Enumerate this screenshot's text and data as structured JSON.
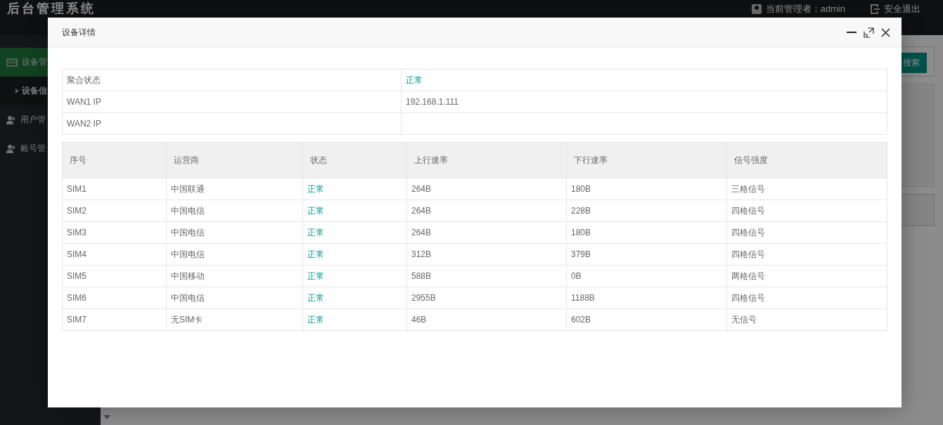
{
  "app": {
    "title": "后台管理系统",
    "admin_label": "当前管理者：admin",
    "logout_label": "安全退出"
  },
  "sidebar": {
    "items": [
      {
        "label": "设备管",
        "selected": true,
        "children": [
          {
            "label": "设备信",
            "selected": false
          }
        ]
      },
      {
        "label": "用户管",
        "selected": false
      },
      {
        "label": "账号管",
        "selected": false
      }
    ]
  },
  "search_button": "搜索",
  "dialog": {
    "title": "设备详情",
    "info": [
      {
        "label": "聚合状态",
        "value": "正常",
        "kind": "status"
      },
      {
        "label": "WAN1 IP",
        "value": "192.168.1.111",
        "kind": "text"
      },
      {
        "label": "WAN2 IP",
        "kind": "text"
      }
    ],
    "table": {
      "columns": [
        {
          "label": "序号",
          "kind": "text"
        },
        {
          "label": "运营商",
          "kind": "text"
        },
        {
          "label": "状态",
          "kind": "status"
        },
        {
          "label": "上行速率",
          "kind": "text"
        },
        {
          "label": "下行速率",
          "kind": "text"
        },
        {
          "label": "信号强度",
          "kind": "text"
        }
      ],
      "rows": [
        [
          "SIM1",
          "中国联通",
          "正常",
          "264B",
          "180B",
          "三格信号"
        ],
        [
          "SIM2",
          "中国电信",
          "正常",
          "264B",
          "228B",
          "四格信号"
        ],
        [
          "SIM3",
          "中国电信",
          "正常",
          "264B",
          "180B",
          "四格信号"
        ],
        [
          "SIM4",
          "中国电信",
          "正常",
          "312B",
          "379B",
          "四格信号"
        ],
        [
          "SIM5",
          "中国移动",
          "正常",
          "588B",
          "0B",
          "两格信号"
        ],
        [
          "SIM6",
          "中国电信",
          "正常",
          "2955B",
          "1188B",
          "四格信号"
        ],
        [
          "SIM7",
          "无SIM卡",
          "正常",
          "46B",
          "602B",
          "无信号"
        ]
      ]
    }
  }
}
